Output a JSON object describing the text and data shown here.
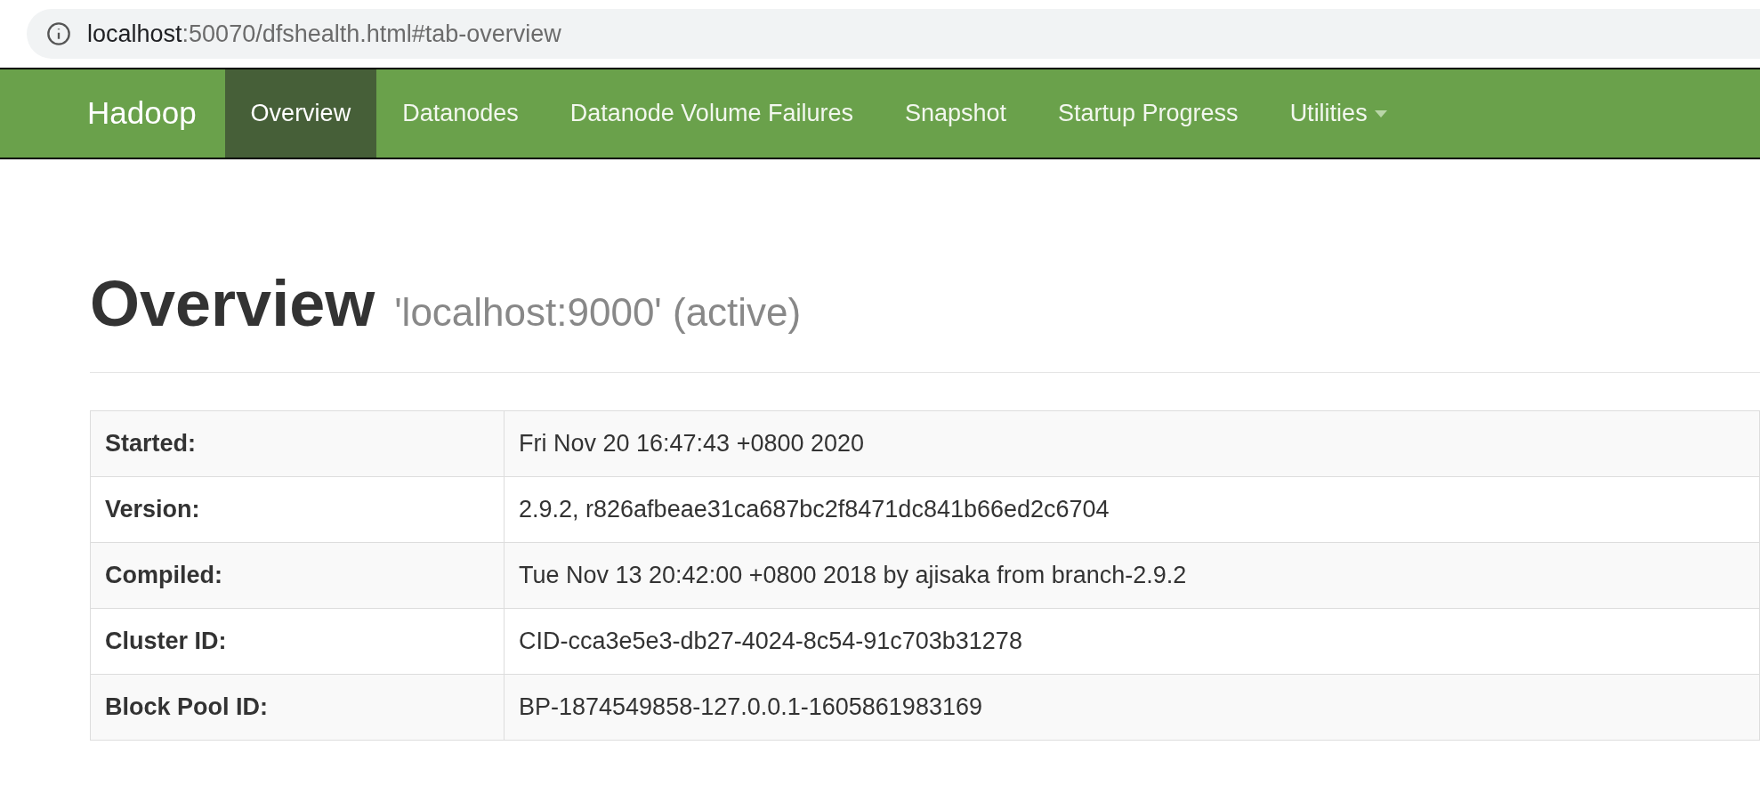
{
  "address_bar": {
    "host": "localhost",
    "path": ":50070/dfshealth.html#tab-overview"
  },
  "navbar": {
    "brand": "Hadoop",
    "items": [
      {
        "label": "Overview",
        "selected": true,
        "dropdown": false
      },
      {
        "label": "Datanodes",
        "selected": false,
        "dropdown": false
      },
      {
        "label": "Datanode Volume Failures",
        "selected": false,
        "dropdown": false
      },
      {
        "label": "Snapshot",
        "selected": false,
        "dropdown": false
      },
      {
        "label": "Startup Progress",
        "selected": false,
        "dropdown": false
      },
      {
        "label": "Utilities",
        "selected": false,
        "dropdown": true
      }
    ]
  },
  "heading": {
    "title": "Overview",
    "subtitle": "'localhost:9000' (active)"
  },
  "table": {
    "rows": [
      {
        "label": "Started:",
        "value": "Fri Nov 20 16:47:43 +0800 2020"
      },
      {
        "label": "Version:",
        "value": "2.9.2, r826afbeae31ca687bc2f8471dc841b66ed2c6704"
      },
      {
        "label": "Compiled:",
        "value": "Tue Nov 13 20:42:00 +0800 2018 by ajisaka from branch-2.9.2"
      },
      {
        "label": "Cluster ID:",
        "value": "CID-cca3e5e3-db27-4024-8c54-91c703b31278"
      },
      {
        "label": "Block Pool ID:",
        "value": "BP-1874549858-127.0.0.1-1605861983169"
      }
    ]
  }
}
